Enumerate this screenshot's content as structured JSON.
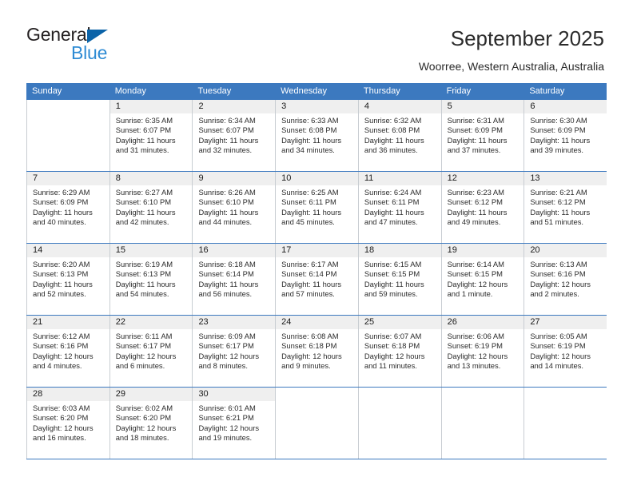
{
  "brand": {
    "name_part1": "General",
    "name_part2": "Blue",
    "triangle_icon": "triangle-icon"
  },
  "header": {
    "title": "September 2025",
    "subtitle": "Woorree, Western Australia, Australia"
  },
  "colors": {
    "header_blue": "#3c79bf",
    "logo_blue": "#2e8bd4",
    "logo_triangle": "#0b63a8",
    "daynum_gray": "#efefef",
    "cell_border": "#c8cdd2"
  },
  "weekdays": [
    "Sunday",
    "Monday",
    "Tuesday",
    "Wednesday",
    "Thursday",
    "Friday",
    "Saturday"
  ],
  "labels": {
    "sunrise_prefix": "Sunrise:",
    "sunset_prefix": "Sunset:",
    "daylight_prefix": "Daylight:"
  },
  "weeks": [
    [
      {
        "empty": true
      },
      {
        "day": "1",
        "sunrise": "Sunrise: 6:35 AM",
        "sunset": "Sunset: 6:07 PM",
        "daylight": "Daylight: 11 hours and 31 minutes."
      },
      {
        "day": "2",
        "sunrise": "Sunrise: 6:34 AM",
        "sunset": "Sunset: 6:07 PM",
        "daylight": "Daylight: 11 hours and 32 minutes."
      },
      {
        "day": "3",
        "sunrise": "Sunrise: 6:33 AM",
        "sunset": "Sunset: 6:08 PM",
        "daylight": "Daylight: 11 hours and 34 minutes."
      },
      {
        "day": "4",
        "sunrise": "Sunrise: 6:32 AM",
        "sunset": "Sunset: 6:08 PM",
        "daylight": "Daylight: 11 hours and 36 minutes."
      },
      {
        "day": "5",
        "sunrise": "Sunrise: 6:31 AM",
        "sunset": "Sunset: 6:09 PM",
        "daylight": "Daylight: 11 hours and 37 minutes."
      },
      {
        "day": "6",
        "sunrise": "Sunrise: 6:30 AM",
        "sunset": "Sunset: 6:09 PM",
        "daylight": "Daylight: 11 hours and 39 minutes."
      }
    ],
    [
      {
        "day": "7",
        "sunrise": "Sunrise: 6:29 AM",
        "sunset": "Sunset: 6:09 PM",
        "daylight": "Daylight: 11 hours and 40 minutes."
      },
      {
        "day": "8",
        "sunrise": "Sunrise: 6:27 AM",
        "sunset": "Sunset: 6:10 PM",
        "daylight": "Daylight: 11 hours and 42 minutes."
      },
      {
        "day": "9",
        "sunrise": "Sunrise: 6:26 AM",
        "sunset": "Sunset: 6:10 PM",
        "daylight": "Daylight: 11 hours and 44 minutes."
      },
      {
        "day": "10",
        "sunrise": "Sunrise: 6:25 AM",
        "sunset": "Sunset: 6:11 PM",
        "daylight": "Daylight: 11 hours and 45 minutes."
      },
      {
        "day": "11",
        "sunrise": "Sunrise: 6:24 AM",
        "sunset": "Sunset: 6:11 PM",
        "daylight": "Daylight: 11 hours and 47 minutes."
      },
      {
        "day": "12",
        "sunrise": "Sunrise: 6:23 AM",
        "sunset": "Sunset: 6:12 PM",
        "daylight": "Daylight: 11 hours and 49 minutes."
      },
      {
        "day": "13",
        "sunrise": "Sunrise: 6:21 AM",
        "sunset": "Sunset: 6:12 PM",
        "daylight": "Daylight: 11 hours and 51 minutes."
      }
    ],
    [
      {
        "day": "14",
        "sunrise": "Sunrise: 6:20 AM",
        "sunset": "Sunset: 6:13 PM",
        "daylight": "Daylight: 11 hours and 52 minutes."
      },
      {
        "day": "15",
        "sunrise": "Sunrise: 6:19 AM",
        "sunset": "Sunset: 6:13 PM",
        "daylight": "Daylight: 11 hours and 54 minutes."
      },
      {
        "day": "16",
        "sunrise": "Sunrise: 6:18 AM",
        "sunset": "Sunset: 6:14 PM",
        "daylight": "Daylight: 11 hours and 56 minutes."
      },
      {
        "day": "17",
        "sunrise": "Sunrise: 6:17 AM",
        "sunset": "Sunset: 6:14 PM",
        "daylight": "Daylight: 11 hours and 57 minutes."
      },
      {
        "day": "18",
        "sunrise": "Sunrise: 6:15 AM",
        "sunset": "Sunset: 6:15 PM",
        "daylight": "Daylight: 11 hours and 59 minutes."
      },
      {
        "day": "19",
        "sunrise": "Sunrise: 6:14 AM",
        "sunset": "Sunset: 6:15 PM",
        "daylight": "Daylight: 12 hours and 1 minute."
      },
      {
        "day": "20",
        "sunrise": "Sunrise: 6:13 AM",
        "sunset": "Sunset: 6:16 PM",
        "daylight": "Daylight: 12 hours and 2 minutes."
      }
    ],
    [
      {
        "day": "21",
        "sunrise": "Sunrise: 6:12 AM",
        "sunset": "Sunset: 6:16 PM",
        "daylight": "Daylight: 12 hours and 4 minutes."
      },
      {
        "day": "22",
        "sunrise": "Sunrise: 6:11 AM",
        "sunset": "Sunset: 6:17 PM",
        "daylight": "Daylight: 12 hours and 6 minutes."
      },
      {
        "day": "23",
        "sunrise": "Sunrise: 6:09 AM",
        "sunset": "Sunset: 6:17 PM",
        "daylight": "Daylight: 12 hours and 8 minutes."
      },
      {
        "day": "24",
        "sunrise": "Sunrise: 6:08 AM",
        "sunset": "Sunset: 6:18 PM",
        "daylight": "Daylight: 12 hours and 9 minutes."
      },
      {
        "day": "25",
        "sunrise": "Sunrise: 6:07 AM",
        "sunset": "Sunset: 6:18 PM",
        "daylight": "Daylight: 12 hours and 11 minutes."
      },
      {
        "day": "26",
        "sunrise": "Sunrise: 6:06 AM",
        "sunset": "Sunset: 6:19 PM",
        "daylight": "Daylight: 12 hours and 13 minutes."
      },
      {
        "day": "27",
        "sunrise": "Sunrise: 6:05 AM",
        "sunset": "Sunset: 6:19 PM",
        "daylight": "Daylight: 12 hours and 14 minutes."
      }
    ],
    [
      {
        "day": "28",
        "sunrise": "Sunrise: 6:03 AM",
        "sunset": "Sunset: 6:20 PM",
        "daylight": "Daylight: 12 hours and 16 minutes."
      },
      {
        "day": "29",
        "sunrise": "Sunrise: 6:02 AM",
        "sunset": "Sunset: 6:20 PM",
        "daylight": "Daylight: 12 hours and 18 minutes."
      },
      {
        "day": "30",
        "sunrise": "Sunrise: 6:01 AM",
        "sunset": "Sunset: 6:21 PM",
        "daylight": "Daylight: 12 hours and 19 minutes."
      },
      {
        "empty": true
      },
      {
        "empty": true
      },
      {
        "empty": true
      },
      {
        "empty": true
      }
    ]
  ]
}
